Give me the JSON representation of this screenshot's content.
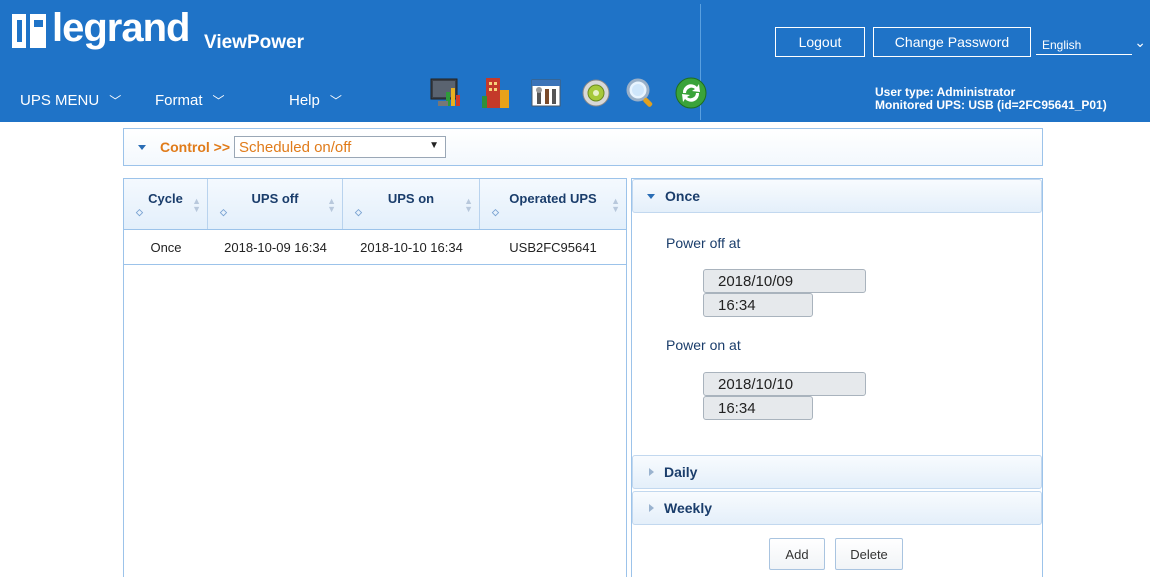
{
  "header": {
    "brand": "legrand",
    "app_name": "ViewPower",
    "logout_label": "Logout",
    "change_password_label": "Change Password",
    "language": "English",
    "user_type": "User type: Administrator",
    "monitored_ups": "Monitored UPS: USB (id=2FC95641_P01)",
    "accent_color": "#1f73c7"
  },
  "menus": [
    {
      "label": "UPS MENU"
    },
    {
      "label": "Format"
    },
    {
      "label": "Help"
    }
  ],
  "toolbar": [
    {
      "icon": "monitor-chart-icon"
    },
    {
      "icon": "building-chart-icon"
    },
    {
      "icon": "configuration-tools-icon"
    },
    {
      "icon": "settings-gear-icon"
    },
    {
      "icon": "search-magnifier-icon"
    },
    {
      "icon": "refresh-icon"
    }
  ],
  "control": {
    "label": "Control >>",
    "selected": "Scheduled on/off",
    "label_color": "#e07b1a"
  },
  "table": {
    "columns": [
      "Cycle",
      "UPS off",
      "UPS on",
      "Operated UPS"
    ],
    "rows": [
      [
        "Once",
        "2018-10-09 16:34",
        "2018-10-10 16:34",
        "USB2FC95641"
      ]
    ]
  },
  "schedule": {
    "once_title": "Once",
    "power_off_label": "Power off at",
    "power_off_date": "2018/10/09",
    "power_off_time": "16:34",
    "power_on_label": "Power on at",
    "power_on_date": "2018/10/10",
    "power_on_time": "16:34",
    "daily_title": "Daily",
    "weekly_title": "Weekly",
    "add_label": "Add",
    "delete_label": "Delete"
  }
}
